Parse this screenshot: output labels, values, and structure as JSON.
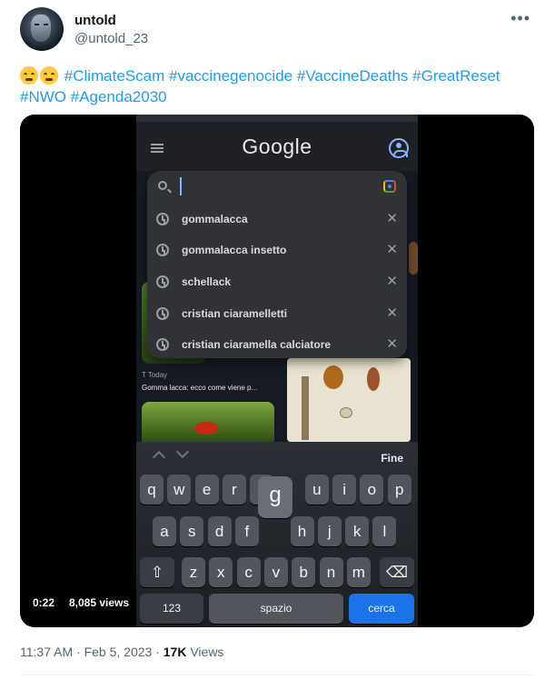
{
  "user": {
    "display_name": "untold",
    "handle": "@untold_23",
    "avatar_icon": "robot-face-avatar"
  },
  "tweet": {
    "emojis": [
      "tired-face-emoji",
      "tired-face-emoji"
    ],
    "hashtags": [
      "#ClimateScam",
      "#vaccinegenocide",
      "#VaccineDeaths",
      "#GreatReset",
      "#NWO",
      "#Agenda2030"
    ]
  },
  "video": {
    "google": {
      "logo": "Google",
      "search_value": "",
      "suggestions": [
        "gommalacca",
        "gommalacca insetto",
        "schellack",
        "cristian ciaramelletti",
        "cristian ciaramella calciatore"
      ],
      "news_source": "Today",
      "news_title": "Gomma lacca: ecco come viene p..."
    },
    "keyboard": {
      "done_label": "Fine",
      "row1": [
        "q",
        "w",
        "e",
        "r",
        "t",
        "y",
        "u",
        "i",
        "o",
        "p"
      ],
      "popup_key": "g",
      "row2": [
        "a",
        "s",
        "d",
        "f",
        "g",
        "h",
        "j",
        "k",
        "l"
      ],
      "row3": [
        "z",
        "x",
        "c",
        "v",
        "b",
        "n",
        "m"
      ],
      "numbers_label": "123",
      "space_label": "spazio",
      "search_label": "cerca"
    },
    "duration": "0:22",
    "views": "8,085 views"
  },
  "meta": {
    "time": "11:37 AM",
    "separator": "·",
    "date": "Feb 5, 2023",
    "views_count": "17K",
    "views_label": "Views"
  },
  "colors": {
    "link": "#1d9bf0",
    "text": "#0f1419",
    "muted": "#536471",
    "search_blue": "#1a73e8"
  }
}
